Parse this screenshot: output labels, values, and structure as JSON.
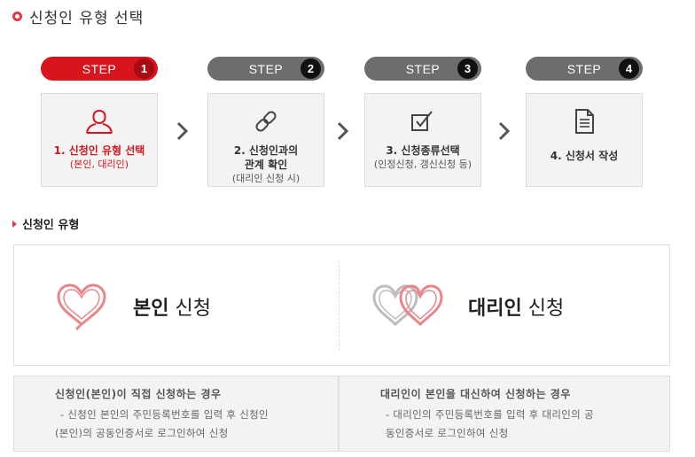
{
  "page": {
    "title": "신청인 유형 선택"
  },
  "steps": [
    {
      "pill": "STEP",
      "number": "1",
      "name": "1. 신청인 유형 선택",
      "sub": "(본인, 대리인)",
      "icon": "person-icon",
      "active": true
    },
    {
      "pill": "STEP",
      "number": "2",
      "name": "2. 신청인과의",
      "name2": "관계 확인",
      "sub": "(대리인 신청 시)",
      "icon": "link-icon",
      "active": false
    },
    {
      "pill": "STEP",
      "number": "3",
      "name": "3. 신청종류선택",
      "sub": "(인정신청, 갱신신청 등)",
      "icon": "checkbox-icon",
      "active": false
    },
    {
      "pill": "STEP",
      "number": "4",
      "name": "4. 신청서 작성",
      "icon": "document-icon",
      "active": false
    }
  ],
  "section": {
    "title": "신청인 유형"
  },
  "types": {
    "self": {
      "bold": "본인",
      "normal": " 신청"
    },
    "agent": {
      "bold": "대리인",
      "normal": " 신청"
    }
  },
  "info": {
    "self": {
      "head": "신청인(본인)이 직접 신청하는 경우",
      "line1": "- 신청인 본인의 주민등록번호를 입력 후 신청인",
      "line2": "(본인)의 공동인증서로 로그인하여 신청"
    },
    "agent": {
      "head": "대리인이 본인을 대신하여 신청하는 경우",
      "line1": "- 대리인의 주민등록번호를 입력 후 대리인의 공",
      "line2": "동인증서로 로그인하여 신청"
    }
  },
  "colors": {
    "accent": "#d8141d",
    "inactive": "#6d6d6d"
  }
}
